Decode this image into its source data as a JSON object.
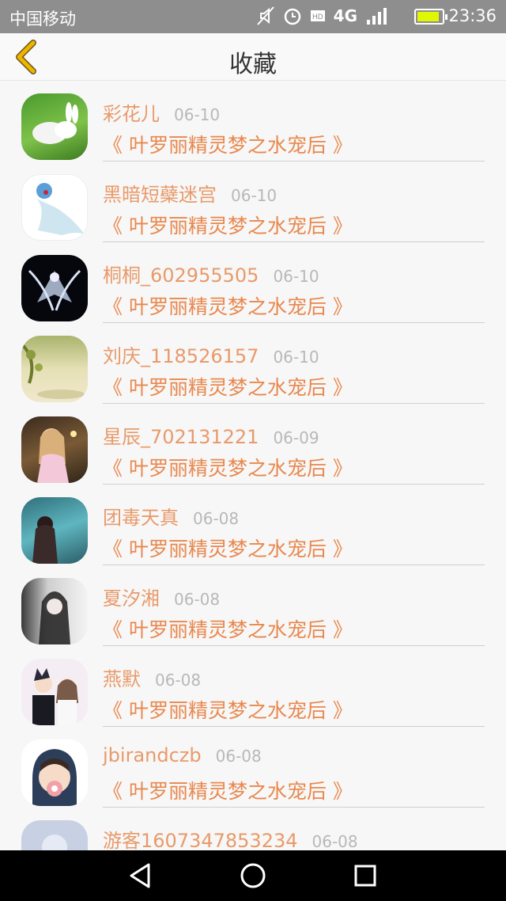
{
  "status": {
    "carrier": "中国移动",
    "network": "4G",
    "time": "23:36",
    "battery_level": 0.9
  },
  "header": {
    "title": "收藏"
  },
  "rows": [
    {
      "name": "彩花儿",
      "date": "06-10",
      "book": "《 叶罗丽精灵梦之水宠后 》"
    },
    {
      "name": "黑暗短蘗迷宫",
      "date": "06-10",
      "book": "《 叶罗丽精灵梦之水宠后 》"
    },
    {
      "name": "桐桐_602955505",
      "date": "06-10",
      "book": "《 叶罗丽精灵梦之水宠后 》"
    },
    {
      "name": "刘庆_118526157",
      "date": "06-10",
      "book": "《 叶罗丽精灵梦之水宠后 》"
    },
    {
      "name": "星辰_702131221",
      "date": "06-09",
      "book": "《 叶罗丽精灵梦之水宠后 》"
    },
    {
      "name": "团毒天真",
      "date": "06-08",
      "book": "《 叶罗丽精灵梦之水宠后 》"
    },
    {
      "name": "夏汐湘",
      "date": "06-08",
      "book": "《 叶罗丽精灵梦之水宠后 》"
    },
    {
      "name": "燕默",
      "date": "06-08",
      "book": "《 叶罗丽精灵梦之水宠后 》"
    },
    {
      "name": "jbirandczb",
      "date": "06-08",
      "book": "《 叶罗丽精灵梦之水宠后 》"
    },
    {
      "name": "游客1607347853234",
      "date": "06-08",
      "book": ""
    }
  ],
  "colors": {
    "accent": "#e8884e",
    "back_icon": "#f0b400"
  }
}
